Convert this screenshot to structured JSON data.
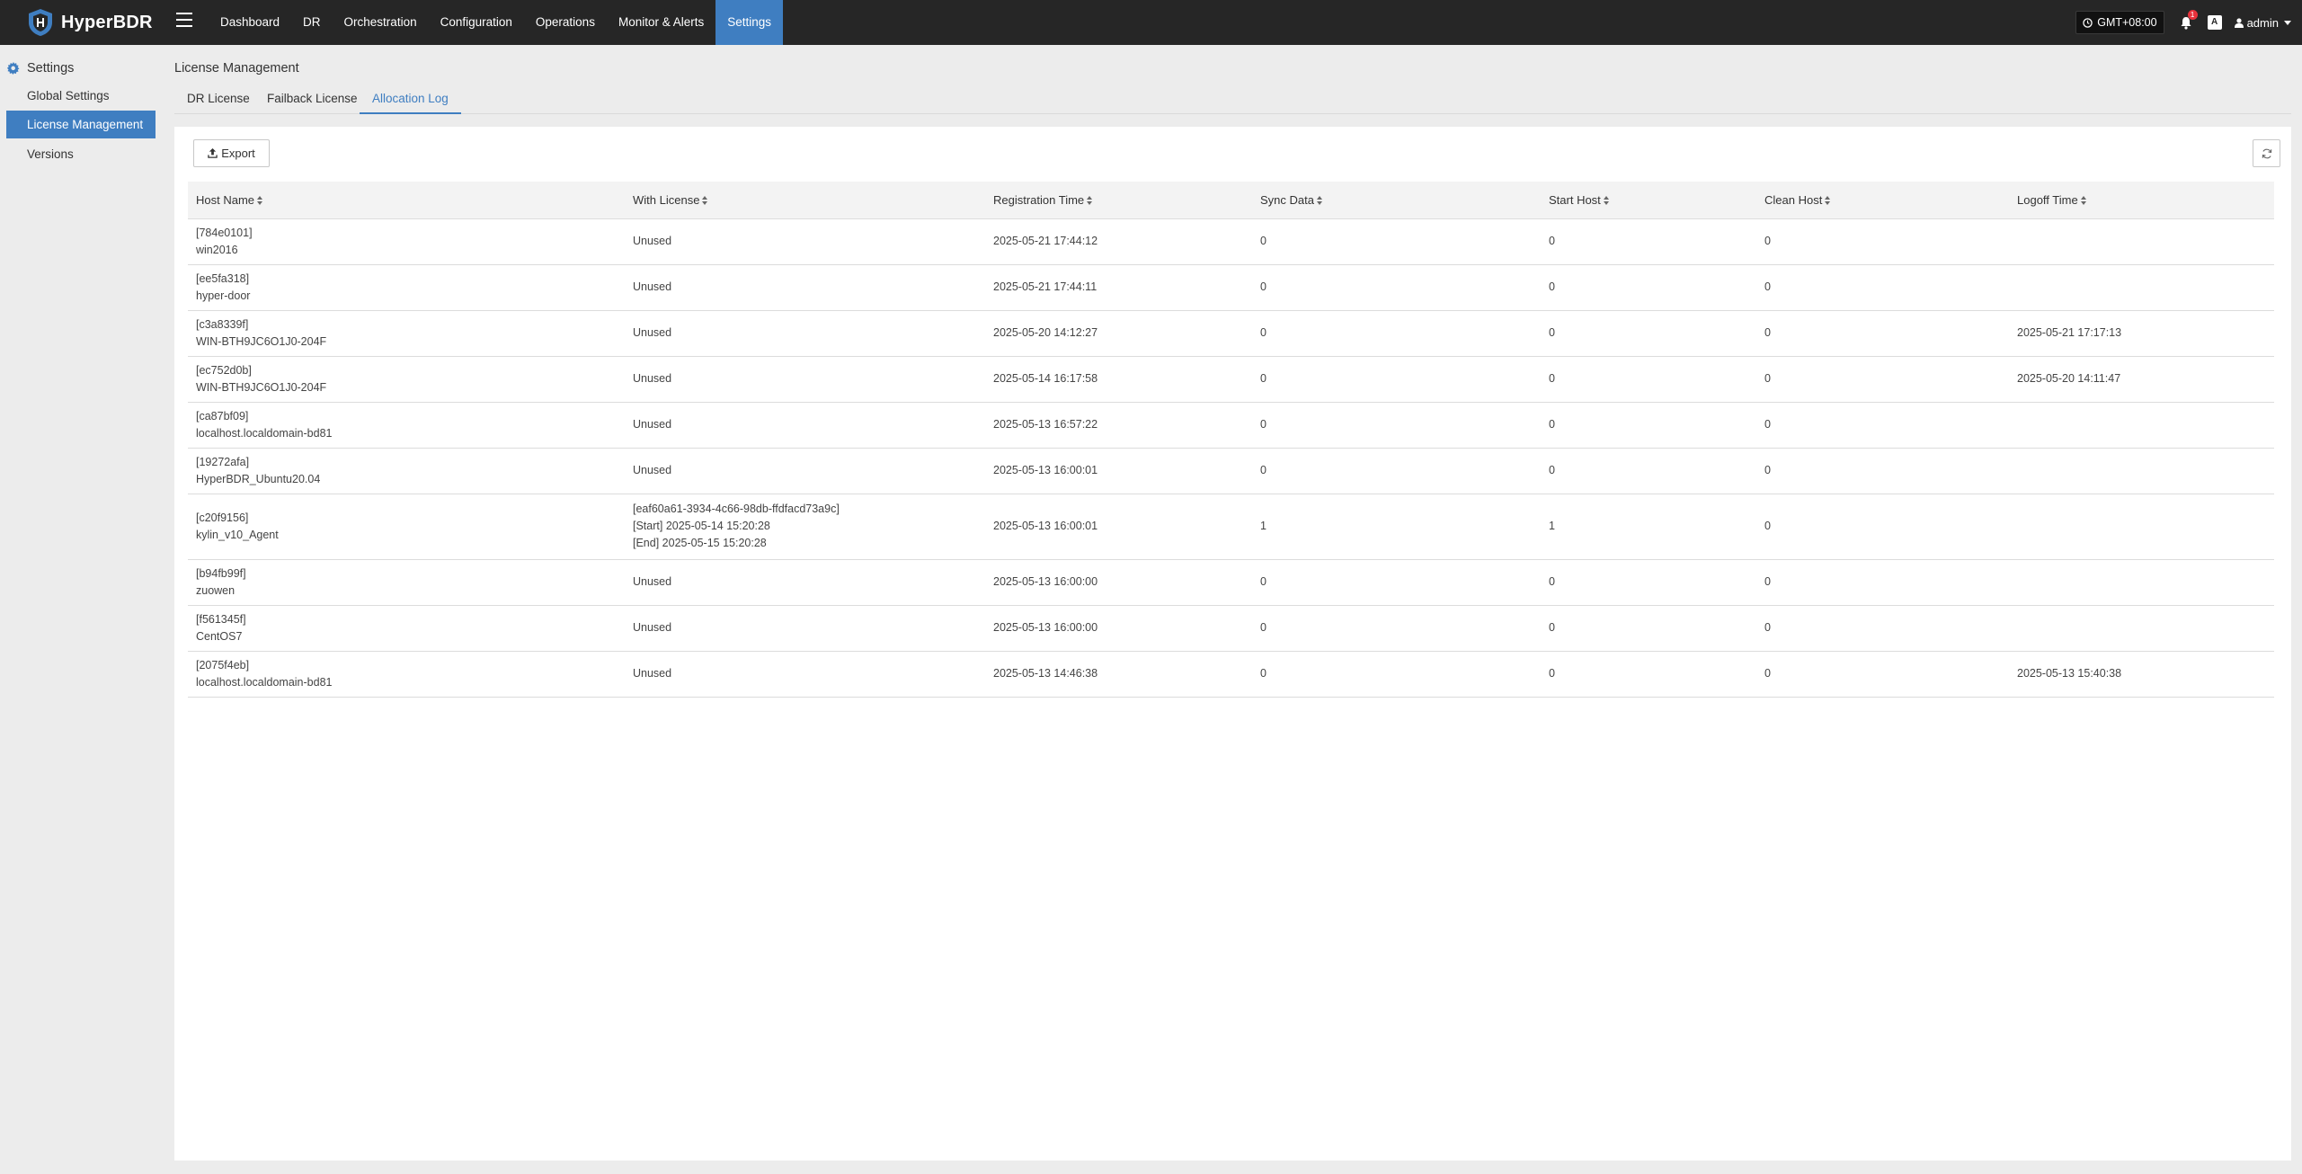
{
  "app": {
    "name": "HyperBDR"
  },
  "nav": {
    "items": [
      {
        "label": "Dashboard",
        "active": false
      },
      {
        "label": "DR",
        "active": false
      },
      {
        "label": "Orchestration",
        "active": false
      },
      {
        "label": "Configuration",
        "active": false
      },
      {
        "label": "Operations",
        "active": false
      },
      {
        "label": "Monitor & Alerts",
        "active": false
      },
      {
        "label": "Settings",
        "active": true
      }
    ],
    "timezone": "GMT+08:00",
    "notification_count": "1",
    "lang_glyph": "A",
    "user": "admin"
  },
  "sidebar": {
    "title": "Settings",
    "items": [
      {
        "label": "Global Settings",
        "active": false
      },
      {
        "label": "License Management",
        "active": true
      },
      {
        "label": "Versions",
        "active": false
      }
    ]
  },
  "page": {
    "title": "License Management",
    "tabs": [
      {
        "label": "DR License",
        "active": false
      },
      {
        "label": "Failback License",
        "active": false
      },
      {
        "label": "Allocation Log",
        "active": true
      }
    ]
  },
  "toolbar": {
    "export_label": "Export"
  },
  "table": {
    "columns": [
      "Host Name",
      "With License",
      "Registration Time",
      "Sync Data",
      "Start Host",
      "Clean Host",
      "Logoff Time"
    ],
    "rows": [
      {
        "host_id": "[784e0101]",
        "host_name": "win2016",
        "license": [
          "Unused"
        ],
        "registration": "2025-05-21 17:44:12",
        "sync": "0",
        "start": "0",
        "clean": "0",
        "logoff": ""
      },
      {
        "host_id": "[ee5fa318]",
        "host_name": "hyper-door",
        "license": [
          "Unused"
        ],
        "registration": "2025-05-21 17:44:11",
        "sync": "0",
        "start": "0",
        "clean": "0",
        "logoff": ""
      },
      {
        "host_id": "[c3a8339f]",
        "host_name": "WIN-BTH9JC6O1J0-204F",
        "license": [
          "Unused"
        ],
        "registration": "2025-05-20 14:12:27",
        "sync": "0",
        "start": "0",
        "clean": "0",
        "logoff": "2025-05-21 17:17:13"
      },
      {
        "host_id": "[ec752d0b]",
        "host_name": "WIN-BTH9JC6O1J0-204F",
        "license": [
          "Unused"
        ],
        "registration": "2025-05-14 16:17:58",
        "sync": "0",
        "start": "0",
        "clean": "0",
        "logoff": "2025-05-20 14:11:47"
      },
      {
        "host_id": "[ca87bf09]",
        "host_name": "localhost.localdomain-bd81",
        "license": [
          "Unused"
        ],
        "registration": "2025-05-13 16:57:22",
        "sync": "0",
        "start": "0",
        "clean": "0",
        "logoff": ""
      },
      {
        "host_id": "[19272afa]",
        "host_name": "HyperBDR_Ubuntu20.04",
        "license": [
          "Unused"
        ],
        "registration": "2025-05-13 16:00:01",
        "sync": "0",
        "start": "0",
        "clean": "0",
        "logoff": ""
      },
      {
        "host_id": "[c20f9156]",
        "host_name": "kylin_v10_Agent",
        "license": [
          "[eaf60a61-3934-4c66-98db-ffdfacd73a9c]",
          "[Start] 2025-05-14 15:20:28",
          "[End] 2025-05-15 15:20:28"
        ],
        "registration": "2025-05-13 16:00:01",
        "sync": "1",
        "start": "1",
        "clean": "0",
        "logoff": ""
      },
      {
        "host_id": "[b94fb99f]",
        "host_name": "zuowen",
        "license": [
          "Unused"
        ],
        "registration": "2025-05-13 16:00:00",
        "sync": "0",
        "start": "0",
        "clean": "0",
        "logoff": ""
      },
      {
        "host_id": "[f561345f]",
        "host_name": "CentOS7",
        "license": [
          "Unused"
        ],
        "registration": "2025-05-13 16:00:00",
        "sync": "0",
        "start": "0",
        "clean": "0",
        "logoff": ""
      },
      {
        "host_id": "[2075f4eb]",
        "host_name": "localhost.localdomain-bd81",
        "license": [
          "Unused"
        ],
        "registration": "2025-05-13 14:46:38",
        "sync": "0",
        "start": "0",
        "clean": "0",
        "logoff": "2025-05-13 15:40:38"
      }
    ]
  },
  "colors": {
    "accent": "#3f7ec1",
    "topbar": "#262626",
    "badge": "#e8323c"
  }
}
